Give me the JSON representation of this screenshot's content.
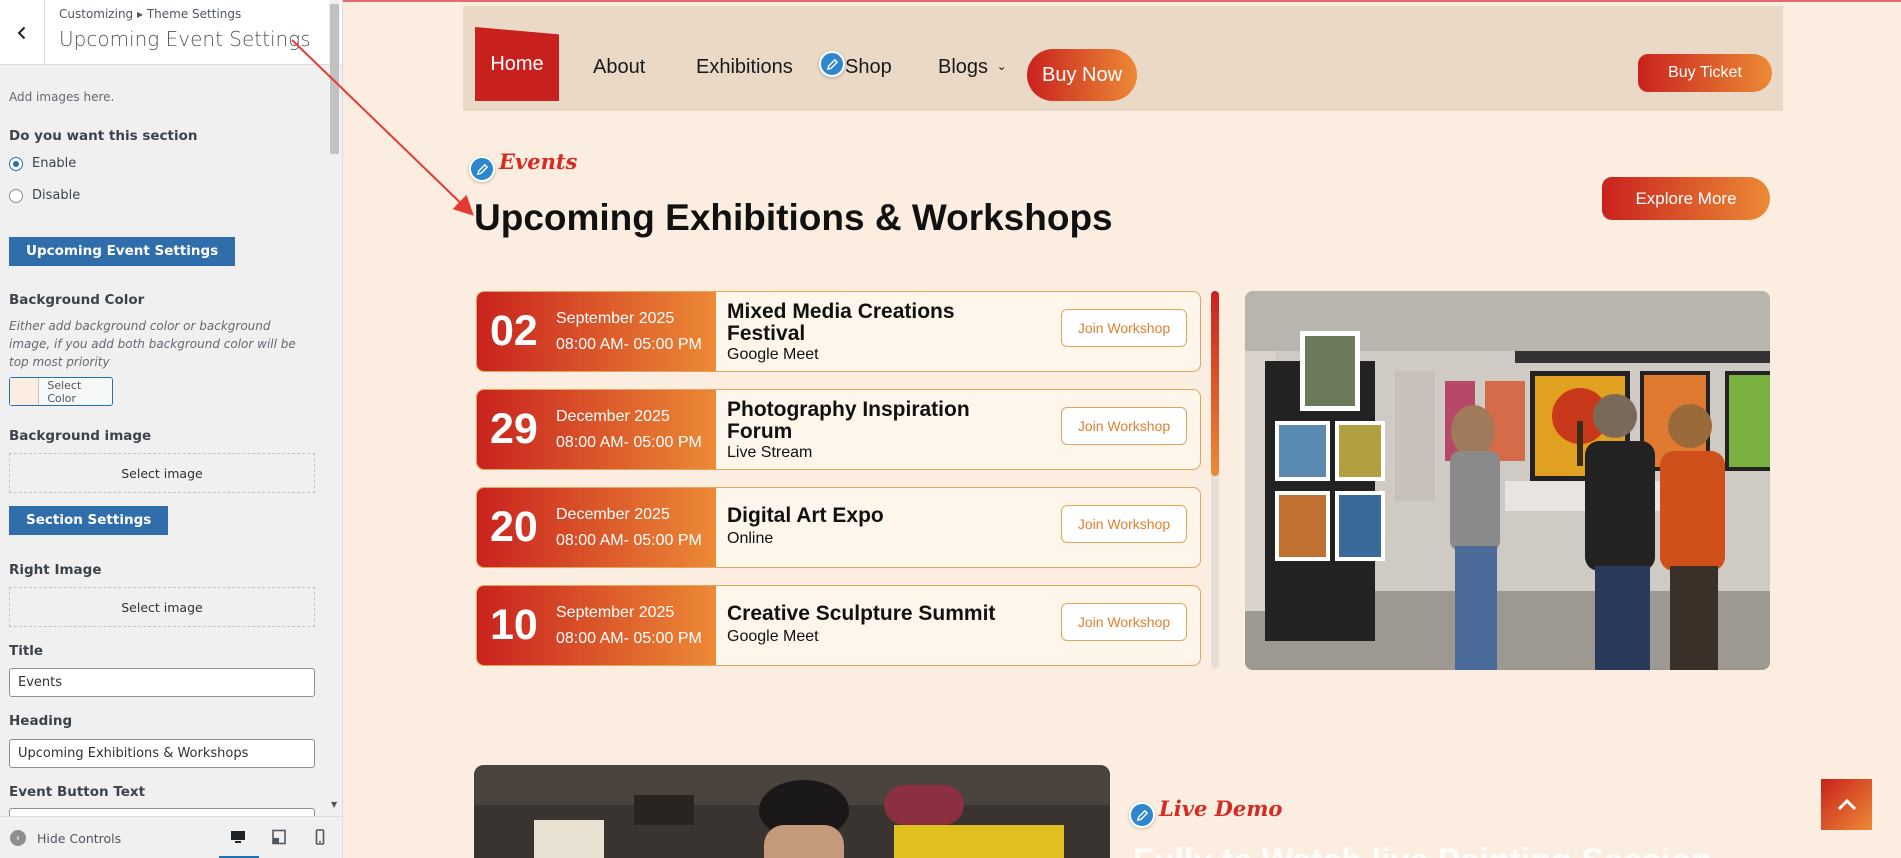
{
  "customizer": {
    "breadcrumb": "Customizing ▸ Theme Settings",
    "section_title": "Upcoming Event Settings",
    "add_images_note": "Add images here.",
    "enable_question": "Do you want this section",
    "radio_enable": "Enable",
    "radio_disable": "Disable",
    "radio_selected": "Enable",
    "upcoming_button": "Upcoming Event Settings",
    "bg_color_label": "Background Color",
    "bg_color_desc": "Either add background color or background image, if you add both background color will be top most priority",
    "select_color": "Select Color",
    "bg_color_value": "#fbeee0",
    "bg_image_label": "Background image",
    "select_image": "Select image",
    "section_settings_button": "Section Settings",
    "right_image_label": "Right Image",
    "title_label": "Title",
    "title_value": "Events",
    "heading_label": "Heading",
    "heading_value": "Upcoming Exhibitions & Workshops",
    "event_button_text_label": "Event Button Text",
    "hide_controls": "Hide Controls",
    "devices": [
      "desktop-icon",
      "tablet-icon",
      "mobile-icon"
    ],
    "active_device": "desktop"
  },
  "site": {
    "nav": {
      "home": "Home",
      "about": "About",
      "exhibitions": "Exhibitions",
      "shop": "Shop",
      "blogs": "Blogs",
      "buy_now": "Buy Now",
      "buy_ticket": "Buy Ticket"
    },
    "events": {
      "kicker": "Events",
      "heading": "Upcoming Exhibitions & Workshops",
      "explore": "Explore More",
      "items": [
        {
          "day": "02",
          "month": "September 2025",
          "time": "08:00 AM- 05:00 PM",
          "title": "Mixed Media Creations Festival",
          "location": "Google Meet",
          "button": "Join Workshop"
        },
        {
          "day": "29",
          "month": "December 2025",
          "time": "08:00 AM- 05:00 PM",
          "title": "Photography Inspiration Forum",
          "location": "Live Stream",
          "button": "Join Workshop"
        },
        {
          "day": "20",
          "month": "December 2025",
          "time": "08:00 AM- 05:00 PM",
          "title": "Digital Art Expo",
          "location": "Online",
          "button": "Join Workshop"
        },
        {
          "day": "10",
          "month": "September 2025",
          "time": "08:00 AM- 05:00 PM",
          "title": "Creative Sculpture Summit",
          "location": "Google Meet",
          "button": "Join Workshop"
        }
      ]
    },
    "live": {
      "kicker": "Live Demo",
      "heading": "Fully te Watch live Painting Session"
    },
    "colors": {
      "accent_red": "#c9221e",
      "accent_orange": "#ec8a35",
      "page_bg": "#fbeee0"
    }
  }
}
